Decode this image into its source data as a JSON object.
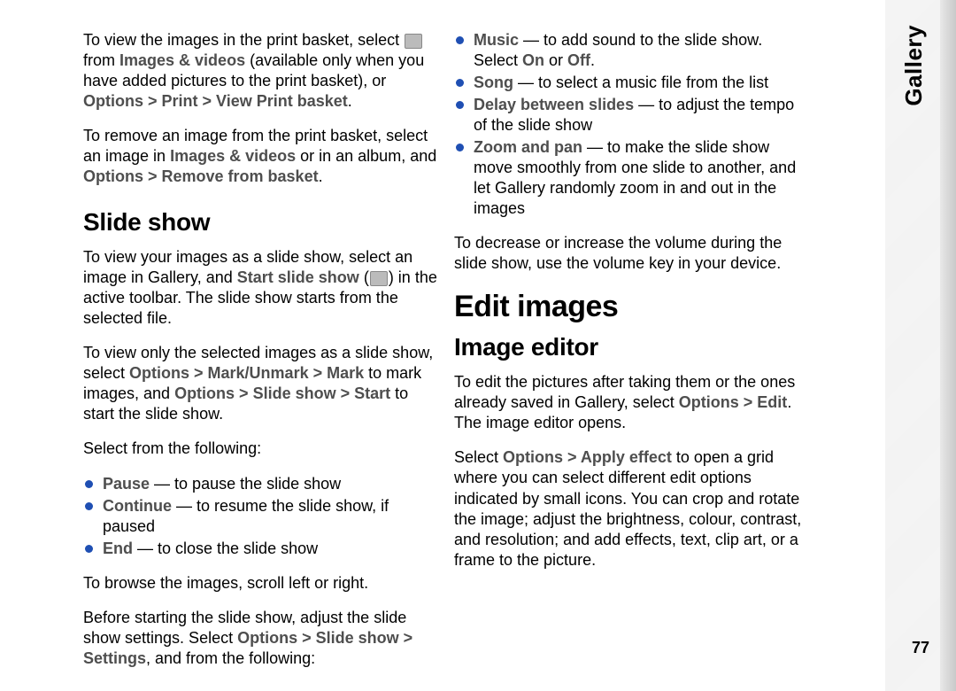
{
  "sideTab": "Gallery",
  "pageNumber": "77",
  "left": {
    "p1_pre": "To view the images in the print basket, select ",
    "p1_mid": " from ",
    "p1_bold1": "Images & videos",
    "p1_mid2": " (available only when you have added pictures to the print basket), or ",
    "p1_path": "Options > Print > View Print basket",
    "p1_end": ".",
    "p2_pre": "To remove an image from the print basket, select an image in ",
    "p2_bold1": "Images & videos",
    "p2_mid": " or in an album, and ",
    "p2_path": "Options > Remove from basket",
    "p2_end": ".",
    "h_slideshow": "Slide show",
    "p3_pre": "To view your images as a slide show, select an image in Gallery, and ",
    "p3_bold": "Start slide show",
    "p3_mid": " (",
    "p3_end": ") in the active toolbar. The slide show starts from the selected file.",
    "p4_pre": "To view only the selected images as a slide show, select ",
    "p4_path1": "Options > Mark/Unmark > Mark",
    "p4_mid": " to mark images, and ",
    "p4_path2": "Options > Slide show > Start",
    "p4_end": " to start the slide show.",
    "p5": "Select from the following:",
    "li_pause_b": "Pause",
    "li_pause_t": " — to pause the slide show",
    "li_cont_b": "Continue",
    "li_cont_t": " — to resume the slide show, if paused",
    "li_end_b": "End",
    "li_end_t": " — to close the slide show",
    "p6": "To browse the images, scroll left or right.",
    "p7_pre": "Before starting the slide show, adjust the slide show settings. Select ",
    "p7_path": "Options > Slide show > Settings",
    "p7_end": ", and from the following:"
  },
  "right": {
    "li_music_b": "Music",
    "li_music_t1": " — to add sound to the slide show. Select ",
    "li_music_on": "On",
    "li_music_or": " or ",
    "li_music_off": "Off",
    "li_music_end": ".",
    "li_song_b": "Song",
    "li_song_t": " — to select a music file from the list",
    "li_delay_b": "Delay between slides",
    "li_delay_t": " — to adjust the tempo of the slide show",
    "li_zoom_b": "Zoom and pan",
    "li_zoom_t": " — to make the slide show move smoothly from one slide to another, and let Gallery randomly zoom in and out in the images",
    "p8": "To decrease or increase the volume during the slide show, use the volume key in your device.",
    "h_edit": "Edit images",
    "h_imgedit": "Image editor",
    "p9_pre": "To edit the pictures after taking them or the ones already saved in Gallery, select ",
    "p9_path": "Options > Edit",
    "p9_end": ". The image editor opens.",
    "p10_pre": "Select ",
    "p10_path": "Options > Apply effect",
    "p10_end": " to open a grid where you can select different edit options indicated by small icons. You can crop and rotate the image; adjust the brightness, colour, contrast, and resolution; and add effects, text, clip art, or a frame to the picture."
  }
}
